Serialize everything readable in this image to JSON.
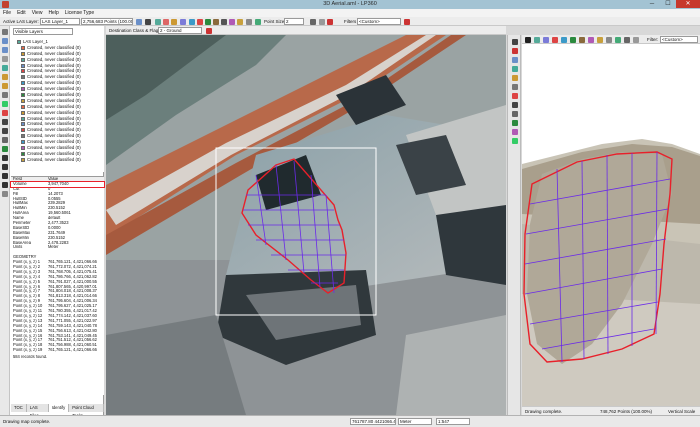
{
  "window": {
    "title": "3D Aerial.aml - LP360",
    "min": "─",
    "max": "☐",
    "close": "✕"
  },
  "menu": [
    "File",
    "Edit",
    "View",
    "Help",
    "License Type"
  ],
  "toolbar": {
    "active_layer_label": "Active LAS Layer:",
    "active_layer_value": "LAS Layer_1",
    "points_count": "2,756,683 Points (100.00%)",
    "point_size_label": "Point Size",
    "point_size_value": "2",
    "filters_label": "Filters",
    "filters_value": "<Custom>"
  },
  "secondary_toolbar": {
    "dest_label": "Destination Class & Flags:",
    "dest_value": "2 - Ground",
    "view2_filter_label": "Filter:",
    "view2_filter_value": "<Custom>"
  },
  "tree": {
    "root": "Visible Layers",
    "layer": "LAS Layer_1",
    "items": [
      "Created, never classified (0)",
      "Created, never classified (0)",
      "Created, never classified (0)",
      "Created, never classified (0)",
      "Created, never classified (0)",
      "Created, never classified (0)",
      "Created, never classified (0)",
      "Created, never classified (0)",
      "Created, never classified (0)",
      "Created, never classified (0)",
      "Created, never classified (0)",
      "Created, never classified (0)",
      "Created, never classified (0)",
      "Created, never classified (0)",
      "Created, never classified (0)",
      "Created, never classified (0)",
      "Created, never classified (0)",
      "Created, never classified (0)",
      "Created, never classified (0)",
      "Created, never classified (0)"
    ]
  },
  "properties": {
    "header_field": "Field",
    "header_value": "Value",
    "rows": [
      {
        "k": "Volume",
        "v": "3,947,7040"
      },
      {
        "k": "Cut",
        "v": "0"
      },
      {
        "k": "Fill",
        "v": "14.2073"
      },
      {
        "k": "HullStD",
        "v": "0.0555"
      },
      {
        "k": "HullMax",
        "v": "239.2829"
      },
      {
        "k": "HullMin",
        "v": "230.5152"
      },
      {
        "k": "HullArea",
        "v": "19,560.5061"
      },
      {
        "k": "Name",
        "v": "default"
      },
      {
        "k": "Perimeter",
        "v": "2,477.3523"
      },
      {
        "k": "BaseStD",
        "v": "0.0000"
      },
      {
        "k": "BaseMax",
        "v": "231.7649"
      },
      {
        "k": "BaseMin",
        "v": "230.5152"
      },
      {
        "k": "BaseArea",
        "v": "2,478.2283"
      },
      {
        "k": "Units",
        "v": "Meter"
      },
      {
        "k": "",
        "v": ""
      },
      {
        "k": "GEOMETRY",
        "v": ""
      },
      {
        "k": "Point (x, y, z) 1",
        "v": "761,765.121, 4,421,066.66"
      },
      {
        "k": "Point (x, y, z) 2",
        "v": "761,772.072, 4,421,074.21"
      },
      {
        "k": "Point (x, y, z) 3",
        "v": "761,768.705, 4,421,075.41"
      },
      {
        "k": "Point (x, y, z) 4",
        "v": "761,786.766, 4,421,062.82"
      },
      {
        "k": "Point (x, y, z) 5",
        "v": "761,791.027, 4,421,000.55"
      },
      {
        "k": "Point (x, y, z) 6",
        "v": "761,807.565, 4,420,997.01"
      },
      {
        "k": "Point (x, y, z) 7",
        "v": "761,804.018, 4,421,008.37"
      },
      {
        "k": "Point (x, y, z) 8",
        "v": "761,813.318, 4,421,014.66"
      },
      {
        "k": "Point (x, y, z) 9",
        "v": "761,795.604, 4,421,006.34"
      },
      {
        "k": "Point (x, y, z) 10",
        "v": "761,795.627, 4,421,025.17"
      },
      {
        "k": "Point (x, y, z) 11",
        "v": "761,780.355, 4,421,017.42"
      },
      {
        "k": "Point (x, y, z) 12",
        "v": "761,774.142, 4,421,037.60"
      },
      {
        "k": "Point (x, y, z) 13",
        "v": "761,771.055, 4,421,022.97"
      },
      {
        "k": "Point (x, y, z) 14",
        "v": "761,759.143, 4,421,040.78"
      },
      {
        "k": "Point (x, y, z) 15",
        "v": "761,756.613, 4,421,042.80"
      },
      {
        "k": "Point (x, y, z) 16",
        "v": "761,753.141, 4,421,049.45"
      },
      {
        "k": "Point (x, y, z) 17",
        "v": "761,751.512, 4,421,056.62"
      },
      {
        "k": "Point (x, y, z) 18",
        "v": "761,756.988, 4,421,060.51"
      },
      {
        "k": "Point (x, y, z) 19",
        "v": "761,765.121, 4,421,066.66"
      }
    ],
    "record_count": "584 records found."
  },
  "panel_tabs": [
    "TOC",
    "LAS Files",
    "Identify",
    "Point Cloud Tasks"
  ],
  "status": {
    "left": "Drawing map complete.",
    "coords": "761787.80 4421066.45",
    "units": "Meter",
    "scale": "1:547",
    "view2_status": "Drawing complete.",
    "view2_points": "748,762 Points (100.00%)",
    "view2_scale": "Vertical Scale"
  },
  "colors": {
    "polygon_edge": "#e8202a",
    "grid": "#6a2ae8",
    "selection_rect": "#ffffff",
    "titlebar": "#a3c3d3"
  }
}
